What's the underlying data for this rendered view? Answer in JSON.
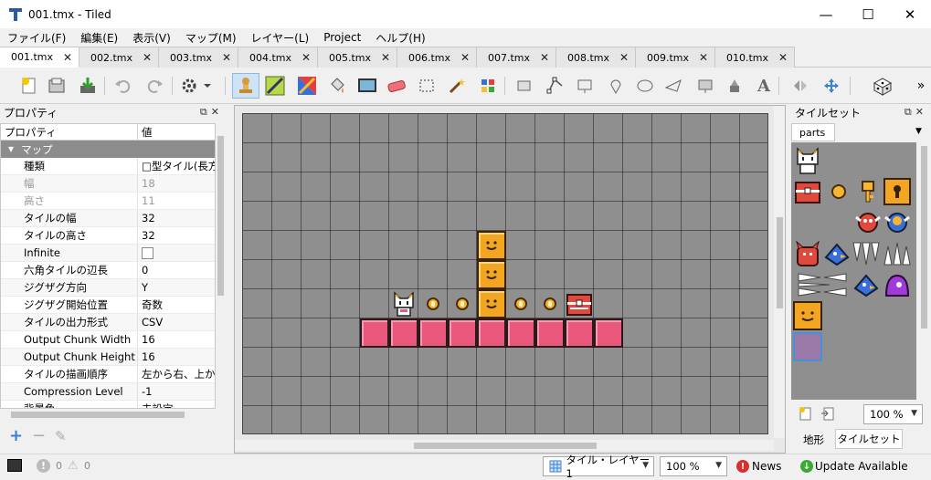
{
  "window": {
    "title": "001.tmx - Tiled",
    "minimize": "—",
    "maximize": "☐",
    "close": "✕"
  },
  "menu": [
    "ファイル(F)",
    "編集(E)",
    "表示(V)",
    "マップ(M)",
    "レイヤー(L)",
    "Project",
    "ヘルプ(H)"
  ],
  "tabs": [
    "001.tmx",
    "002.tmx",
    "003.tmx",
    "004.tmx",
    "005.tmx",
    "006.tmx",
    "007.tmx",
    "008.tmx",
    "009.tmx",
    "010.tmx"
  ],
  "active_tab": 0,
  "tab_close": "✕",
  "toolbar_more": "»",
  "properties": {
    "panel_title": "プロパティ",
    "header_key": "プロパティ",
    "header_value": "値",
    "group": "マップ",
    "rows": [
      {
        "k": "種類",
        "v": "□型タイル(長方"
      },
      {
        "k": "幅",
        "v": "18"
      },
      {
        "k": "高さ",
        "v": "11"
      },
      {
        "k": "タイルの幅",
        "v": "32"
      },
      {
        "k": "タイルの高さ",
        "v": "32"
      },
      {
        "k": "Infinite",
        "v": ""
      },
      {
        "k": "六角タイルの辺長",
        "v": "0"
      },
      {
        "k": "ジグザグ方向",
        "v": "Y"
      },
      {
        "k": "ジグザグ開始位置",
        "v": "奇数"
      },
      {
        "k": "タイルの出力形式",
        "v": "CSV"
      },
      {
        "k": "Output Chunk Width",
        "v": "16"
      },
      {
        "k": "Output Chunk Height",
        "v": "16"
      },
      {
        "k": "タイルの描画順序",
        "v": "左から右、上から"
      },
      {
        "k": "Compression Level",
        "v": "-1"
      },
      {
        "k": "背景色",
        "v": "未設定"
      }
    ],
    "add_btn": "+",
    "remove_btn": "−",
    "edit_btn": "✎"
  },
  "tileset": {
    "panel_title": "タイルセット",
    "tab": "parts",
    "zoom": "100 %",
    "bottom_tabs": [
      "地形",
      "タイルセット"
    ]
  },
  "status": {
    "errors": "0",
    "warnings": "0",
    "layer": "タイル・レイヤー1",
    "zoom": "100 %",
    "news": "News",
    "update": "Update Available"
  },
  "colors": {
    "canvas_bg": "#8f8f8f",
    "pink_block": "#e9587a",
    "box": "#f2a622",
    "coin": "#f6b632",
    "group_header": "#8c8c8c",
    "news_icon": "#d83030",
    "update_icon": "#3aaa35"
  },
  "icons": [
    "new-map-icon",
    "open-icon",
    "save-icon",
    "undo-icon",
    "redo-icon",
    "commands-icon",
    "stamp-brush-icon",
    "terrain-brush-icon",
    "wang-brush-icon",
    "bucket-fill-icon",
    "shape-fill-icon",
    "eraser-icon",
    "rect-select-icon",
    "magic-wand-icon",
    "select-same-tile-icon",
    "select-objects-icon",
    "edit-polygons-icon",
    "insert-rectangle-icon",
    "insert-point-icon",
    "insert-ellipse-icon",
    "insert-polygon-icon",
    "insert-tile-icon",
    "insert-template-icon",
    "insert-text-icon",
    "flip-icon",
    "rotate-icon",
    "random-mode-icon"
  ]
}
